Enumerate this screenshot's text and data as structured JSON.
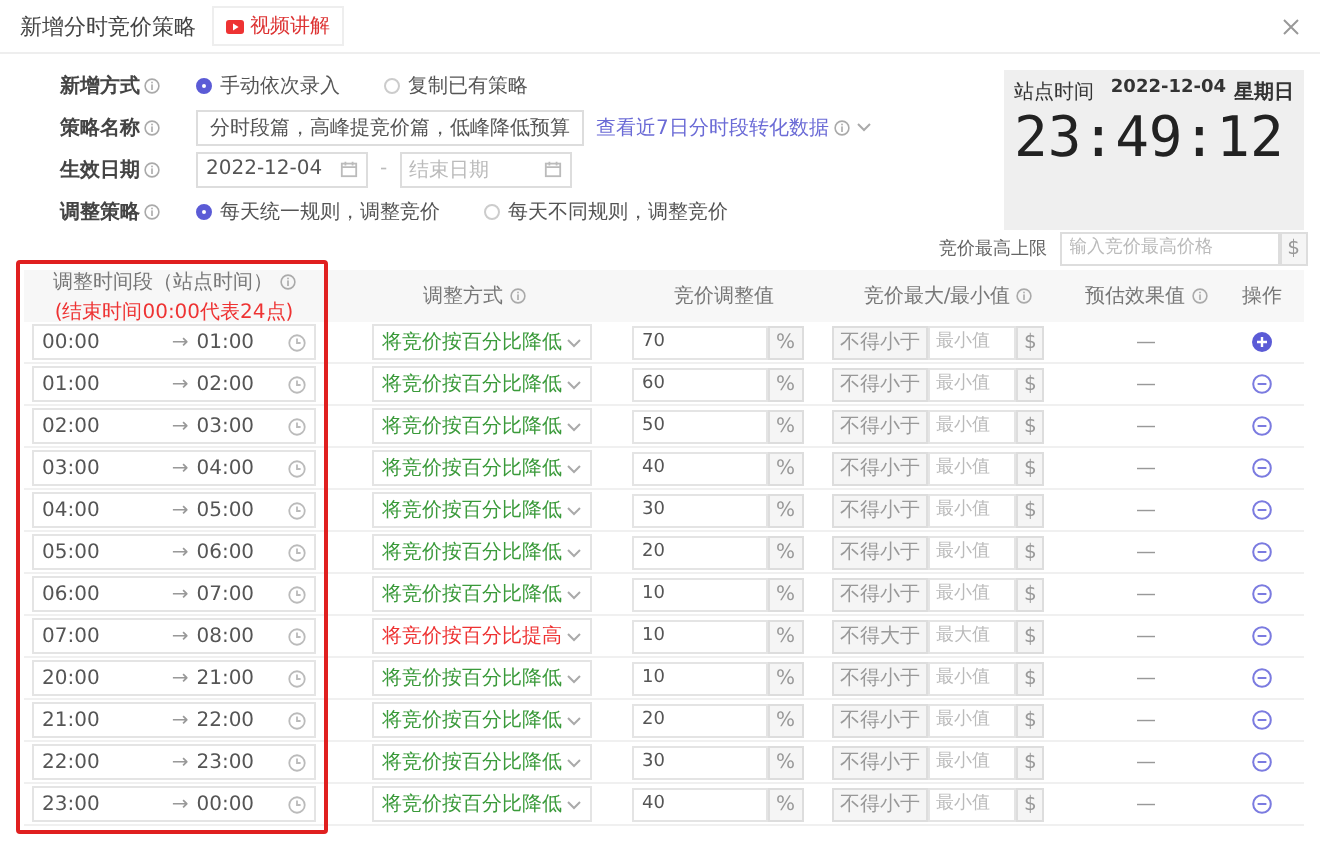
{
  "dialog": {
    "title": "新增分时竞价策略",
    "video_button": "视频讲解"
  },
  "form": [
    {
      "kind": "radio",
      "label": "新增方式",
      "options": [
        {
          "label": "手动依次录入",
          "selected": true
        },
        {
          "label": "复制已有策略",
          "selected": false
        }
      ]
    },
    {
      "kind": "text",
      "label": "策略名称",
      "value": "分时段篇，高峰提竞价篇，低峰降低预算",
      "link": "查看近7日分时段转化数据"
    },
    {
      "kind": "daterange",
      "label": "生效日期",
      "start": "2022-12-04",
      "separator": "-",
      "end_placeholder": "结束日期"
    },
    {
      "kind": "radio",
      "label": "调整策略",
      "options": [
        {
          "label": "每天统一规则，调整竞价",
          "selected": true
        },
        {
          "label": "每天不同规则，调整竞价",
          "selected": false
        }
      ]
    }
  ],
  "clock": {
    "label": "站点时间",
    "date": "2022-12-04",
    "weekday": "星期日",
    "time": "23:49:12"
  },
  "limit": {
    "label": "竞价最高上限",
    "placeholder": "输入竞价最高价格",
    "unit": "$"
  },
  "table": {
    "columns": [
      {
        "label": "调整时间段（站点时间）",
        "note": "(结束时间00:00代表24点)",
        "info": true
      },
      {
        "label": "调整方式",
        "info": true
      },
      {
        "label": "竞价调整值",
        "info": false
      },
      {
        "label": "竞价最大/最小值",
        "info": true
      },
      {
        "label": "预估效果值",
        "info": true
      },
      {
        "label": "操作",
        "info": false
      }
    ],
    "rows": [
      {
        "start": "00:00",
        "separator": "→",
        "end": "01:00",
        "method": "将竞价按百分比降低",
        "kind": "decrease",
        "value": "70",
        "unit": "%",
        "bound_label": "不得小于",
        "bound_placeholder": "最小值",
        "currency": "$",
        "estimate": "—",
        "add": true
      },
      {
        "start": "01:00",
        "separator": "→",
        "end": "02:00",
        "method": "将竞价按百分比降低",
        "kind": "decrease",
        "value": "60",
        "unit": "%",
        "bound_label": "不得小于",
        "bound_placeholder": "最小值",
        "currency": "$",
        "estimate": "—",
        "add": false
      },
      {
        "start": "02:00",
        "separator": "→",
        "end": "03:00",
        "method": "将竞价按百分比降低",
        "kind": "decrease",
        "value": "50",
        "unit": "%",
        "bound_label": "不得小于",
        "bound_placeholder": "最小值",
        "currency": "$",
        "estimate": "—",
        "add": false
      },
      {
        "start": "03:00",
        "separator": "→",
        "end": "04:00",
        "method": "将竞价按百分比降低",
        "kind": "decrease",
        "value": "40",
        "unit": "%",
        "bound_label": "不得小于",
        "bound_placeholder": "最小值",
        "currency": "$",
        "estimate": "—",
        "add": false
      },
      {
        "start": "04:00",
        "separator": "→",
        "end": "05:00",
        "method": "将竞价按百分比降低",
        "kind": "decrease",
        "value": "30",
        "unit": "%",
        "bound_label": "不得小于",
        "bound_placeholder": "最小值",
        "currency": "$",
        "estimate": "—",
        "add": false
      },
      {
        "start": "05:00",
        "separator": "→",
        "end": "06:00",
        "method": "将竞价按百分比降低",
        "kind": "decrease",
        "value": "20",
        "unit": "%",
        "bound_label": "不得小于",
        "bound_placeholder": "最小值",
        "currency": "$",
        "estimate": "—",
        "add": false
      },
      {
        "start": "06:00",
        "separator": "→",
        "end": "07:00",
        "method": "将竞价按百分比降低",
        "kind": "decrease",
        "value": "10",
        "unit": "%",
        "bound_label": "不得小于",
        "bound_placeholder": "最小值",
        "currency": "$",
        "estimate": "—",
        "add": false
      },
      {
        "start": "07:00",
        "separator": "→",
        "end": "08:00",
        "method": "将竞价按百分比提高",
        "kind": "increase",
        "value": "10",
        "unit": "%",
        "bound_label": "不得大于",
        "bound_placeholder": "最大值",
        "currency": "$",
        "estimate": "—",
        "add": false
      },
      {
        "start": "20:00",
        "separator": "→",
        "end": "21:00",
        "method": "将竞价按百分比降低",
        "kind": "decrease",
        "value": "10",
        "unit": "%",
        "bound_label": "不得小于",
        "bound_placeholder": "最小值",
        "currency": "$",
        "estimate": "—",
        "add": false
      },
      {
        "start": "21:00",
        "separator": "→",
        "end": "22:00",
        "method": "将竞价按百分比降低",
        "kind": "decrease",
        "value": "20",
        "unit": "%",
        "bound_label": "不得小于",
        "bound_placeholder": "最小值",
        "currency": "$",
        "estimate": "—",
        "add": false
      },
      {
        "start": "22:00",
        "separator": "→",
        "end": "23:00",
        "method": "将竞价按百分比降低",
        "kind": "decrease",
        "value": "30",
        "unit": "%",
        "bound_label": "不得小于",
        "bound_placeholder": "最小值",
        "currency": "$",
        "estimate": "—",
        "add": false
      },
      {
        "start": "23:00",
        "separator": "→",
        "end": "00:00",
        "method": "将竞价按百分比降低",
        "kind": "decrease",
        "value": "40",
        "unit": "%",
        "bound_label": "不得小于",
        "bound_placeholder": "最小值",
        "currency": "$",
        "estimate": "—",
        "add": false
      }
    ]
  }
}
